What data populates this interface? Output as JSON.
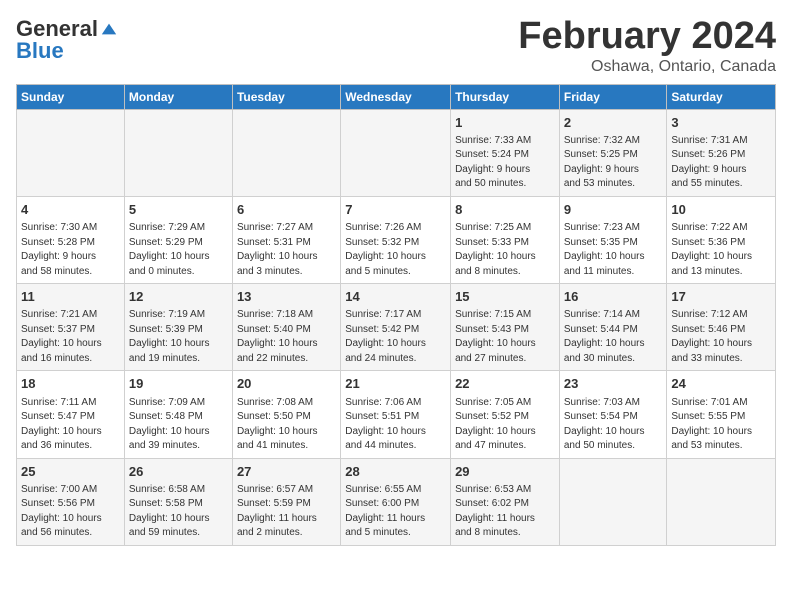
{
  "logo": {
    "general": "General",
    "blue": "Blue"
  },
  "title": "February 2024",
  "subtitle": "Oshawa, Ontario, Canada",
  "days_header": [
    "Sunday",
    "Monday",
    "Tuesday",
    "Wednesday",
    "Thursday",
    "Friday",
    "Saturday"
  ],
  "weeks": [
    [
      {
        "day": "",
        "info": ""
      },
      {
        "day": "",
        "info": ""
      },
      {
        "day": "",
        "info": ""
      },
      {
        "day": "",
        "info": ""
      },
      {
        "day": "1",
        "info": "Sunrise: 7:33 AM\nSunset: 5:24 PM\nDaylight: 9 hours\nand 50 minutes."
      },
      {
        "day": "2",
        "info": "Sunrise: 7:32 AM\nSunset: 5:25 PM\nDaylight: 9 hours\nand 53 minutes."
      },
      {
        "day": "3",
        "info": "Sunrise: 7:31 AM\nSunset: 5:26 PM\nDaylight: 9 hours\nand 55 minutes."
      }
    ],
    [
      {
        "day": "4",
        "info": "Sunrise: 7:30 AM\nSunset: 5:28 PM\nDaylight: 9 hours\nand 58 minutes."
      },
      {
        "day": "5",
        "info": "Sunrise: 7:29 AM\nSunset: 5:29 PM\nDaylight: 10 hours\nand 0 minutes."
      },
      {
        "day": "6",
        "info": "Sunrise: 7:27 AM\nSunset: 5:31 PM\nDaylight: 10 hours\nand 3 minutes."
      },
      {
        "day": "7",
        "info": "Sunrise: 7:26 AM\nSunset: 5:32 PM\nDaylight: 10 hours\nand 5 minutes."
      },
      {
        "day": "8",
        "info": "Sunrise: 7:25 AM\nSunset: 5:33 PM\nDaylight: 10 hours\nand 8 minutes."
      },
      {
        "day": "9",
        "info": "Sunrise: 7:23 AM\nSunset: 5:35 PM\nDaylight: 10 hours\nand 11 minutes."
      },
      {
        "day": "10",
        "info": "Sunrise: 7:22 AM\nSunset: 5:36 PM\nDaylight: 10 hours\nand 13 minutes."
      }
    ],
    [
      {
        "day": "11",
        "info": "Sunrise: 7:21 AM\nSunset: 5:37 PM\nDaylight: 10 hours\nand 16 minutes."
      },
      {
        "day": "12",
        "info": "Sunrise: 7:19 AM\nSunset: 5:39 PM\nDaylight: 10 hours\nand 19 minutes."
      },
      {
        "day": "13",
        "info": "Sunrise: 7:18 AM\nSunset: 5:40 PM\nDaylight: 10 hours\nand 22 minutes."
      },
      {
        "day": "14",
        "info": "Sunrise: 7:17 AM\nSunset: 5:42 PM\nDaylight: 10 hours\nand 24 minutes."
      },
      {
        "day": "15",
        "info": "Sunrise: 7:15 AM\nSunset: 5:43 PM\nDaylight: 10 hours\nand 27 minutes."
      },
      {
        "day": "16",
        "info": "Sunrise: 7:14 AM\nSunset: 5:44 PM\nDaylight: 10 hours\nand 30 minutes."
      },
      {
        "day": "17",
        "info": "Sunrise: 7:12 AM\nSunset: 5:46 PM\nDaylight: 10 hours\nand 33 minutes."
      }
    ],
    [
      {
        "day": "18",
        "info": "Sunrise: 7:11 AM\nSunset: 5:47 PM\nDaylight: 10 hours\nand 36 minutes."
      },
      {
        "day": "19",
        "info": "Sunrise: 7:09 AM\nSunset: 5:48 PM\nDaylight: 10 hours\nand 39 minutes."
      },
      {
        "day": "20",
        "info": "Sunrise: 7:08 AM\nSunset: 5:50 PM\nDaylight: 10 hours\nand 41 minutes."
      },
      {
        "day": "21",
        "info": "Sunrise: 7:06 AM\nSunset: 5:51 PM\nDaylight: 10 hours\nand 44 minutes."
      },
      {
        "day": "22",
        "info": "Sunrise: 7:05 AM\nSunset: 5:52 PM\nDaylight: 10 hours\nand 47 minutes."
      },
      {
        "day": "23",
        "info": "Sunrise: 7:03 AM\nSunset: 5:54 PM\nDaylight: 10 hours\nand 50 minutes."
      },
      {
        "day": "24",
        "info": "Sunrise: 7:01 AM\nSunset: 5:55 PM\nDaylight: 10 hours\nand 53 minutes."
      }
    ],
    [
      {
        "day": "25",
        "info": "Sunrise: 7:00 AM\nSunset: 5:56 PM\nDaylight: 10 hours\nand 56 minutes."
      },
      {
        "day": "26",
        "info": "Sunrise: 6:58 AM\nSunset: 5:58 PM\nDaylight: 10 hours\nand 59 minutes."
      },
      {
        "day": "27",
        "info": "Sunrise: 6:57 AM\nSunset: 5:59 PM\nDaylight: 11 hours\nand 2 minutes."
      },
      {
        "day": "28",
        "info": "Sunrise: 6:55 AM\nSunset: 6:00 PM\nDaylight: 11 hours\nand 5 minutes."
      },
      {
        "day": "29",
        "info": "Sunrise: 6:53 AM\nSunset: 6:02 PM\nDaylight: 11 hours\nand 8 minutes."
      },
      {
        "day": "",
        "info": ""
      },
      {
        "day": "",
        "info": ""
      }
    ]
  ]
}
